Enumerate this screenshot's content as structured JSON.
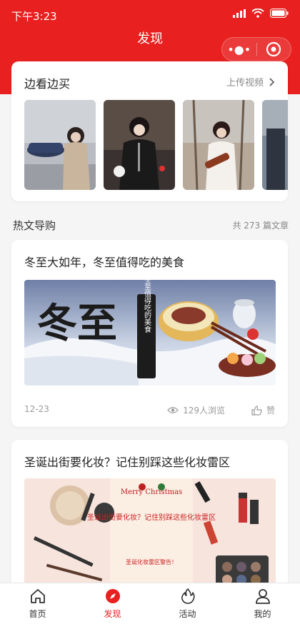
{
  "status": {
    "time": "下午3:23"
  },
  "nav": {
    "title": "发现"
  },
  "watch": {
    "title": "边看边买",
    "upload_label": "上传视频",
    "thumbnails": [
      "video-thumb-1",
      "video-thumb-2",
      "video-thumb-3",
      "video-thumb-4"
    ]
  },
  "hot": {
    "title": "热文导购",
    "count": "共 273 篇文章"
  },
  "articles": [
    {
      "title": "冬至大如年，冬至值得吃的美食",
      "image_text_big": "冬至",
      "image_text_side": "冬至值得吃的美食",
      "date": "12-23",
      "views": "129人浏览",
      "like": "赞"
    },
    {
      "title": "圣诞出街要化妆？记住别踩这些化妆雷区",
      "image_text_top": "Merry Christmas",
      "image_text_main": "圣诞出街要化妆？记住别踩这些化妆雷区",
      "image_text_small": "圣诞化妆雷区警告！"
    }
  ],
  "tabbar": {
    "items": [
      {
        "label": "首页",
        "icon": "home-icon"
      },
      {
        "label": "发现",
        "icon": "compass-icon"
      },
      {
        "label": "活动",
        "icon": "flame-icon"
      },
      {
        "label": "我的",
        "icon": "user-icon"
      }
    ],
    "active_color": "#e8201f"
  },
  "colors": {
    "brand": "#e8201f",
    "background": "#f5f5f5"
  }
}
